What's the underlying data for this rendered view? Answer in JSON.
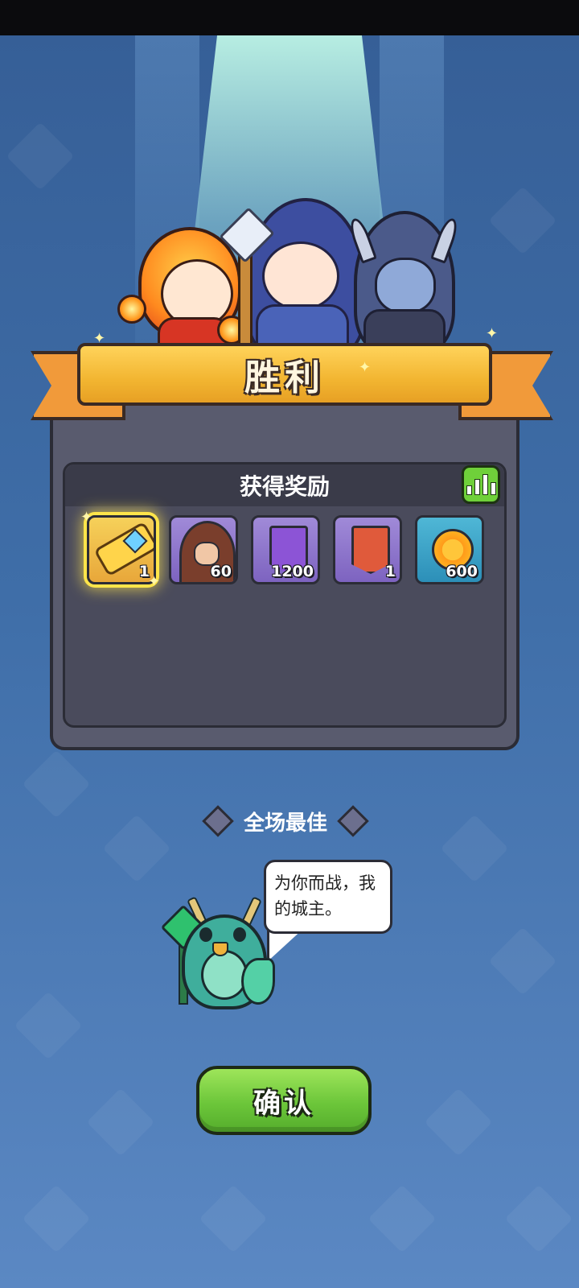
{
  "header": {
    "title": "胜利"
  },
  "rewards": {
    "title": "获得奖励",
    "items": [
      {
        "icon": "golden-key-icon",
        "count": "1",
        "highlight": true
      },
      {
        "icon": "hooded-hero-icon",
        "count": "60"
      },
      {
        "icon": "purple-banner-icon",
        "count": "1200"
      },
      {
        "icon": "red-flag-banner-icon",
        "count": "1"
      },
      {
        "icon": "gold-coin-icon",
        "count": "600"
      }
    ]
  },
  "mvp": {
    "label": "全场最佳",
    "speech": "为你而战，我的城主。"
  },
  "confirm": {
    "label": "确认"
  },
  "colors": {
    "accent_gold": "#f2b531",
    "button_green": "#6cc63a",
    "panel": "#595b6e"
  }
}
